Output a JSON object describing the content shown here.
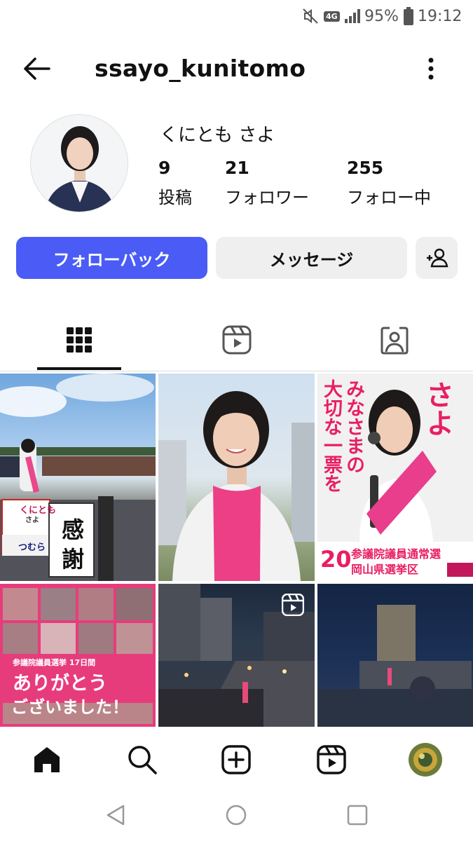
{
  "status_bar": {
    "network": "4G",
    "battery": "95%",
    "time": "19:12"
  },
  "header": {
    "username": "ssayo_kunitomo",
    "back_icon": "arrow-left-icon",
    "more_icon": "more-vertical-icon"
  },
  "profile": {
    "display_name": "くにとも さよ",
    "stats": [
      {
        "value": "9",
        "label": "投稿"
      },
      {
        "value": "21",
        "label": "フォロワー"
      },
      {
        "value": "255",
        "label": "フォロー中"
      }
    ]
  },
  "actions": {
    "follow_back": "フォローバック",
    "message": "メッセージ",
    "accent_color": "#4a5cf5"
  },
  "tabs": [
    {
      "icon": "grid-icon",
      "selected": true
    },
    {
      "icon": "reels-icon",
      "selected": false
    },
    {
      "icon": "tagged-icon",
      "selected": false
    }
  ],
  "posts": [
    {
      "overlay": [
        "くにとも",
        "さよ",
        "つむら",
        "感",
        "謝"
      ]
    },
    {
      "overlay": []
    },
    {
      "overlay": [
        "さよ",
        "みなさまの",
        "大切な一票を",
        "参議院議員通常選",
        "岡山県選挙区",
        "20"
      ]
    },
    {
      "overlay": [
        "参議院議員選挙 17日間",
        "ありがとう",
        "ございました！"
      ]
    },
    {
      "overlay": []
    },
    {
      "overlay": []
    }
  ],
  "bottom_nav": [
    "home-icon",
    "search-icon",
    "create-icon",
    "reels-icon",
    "profile-avatar"
  ]
}
